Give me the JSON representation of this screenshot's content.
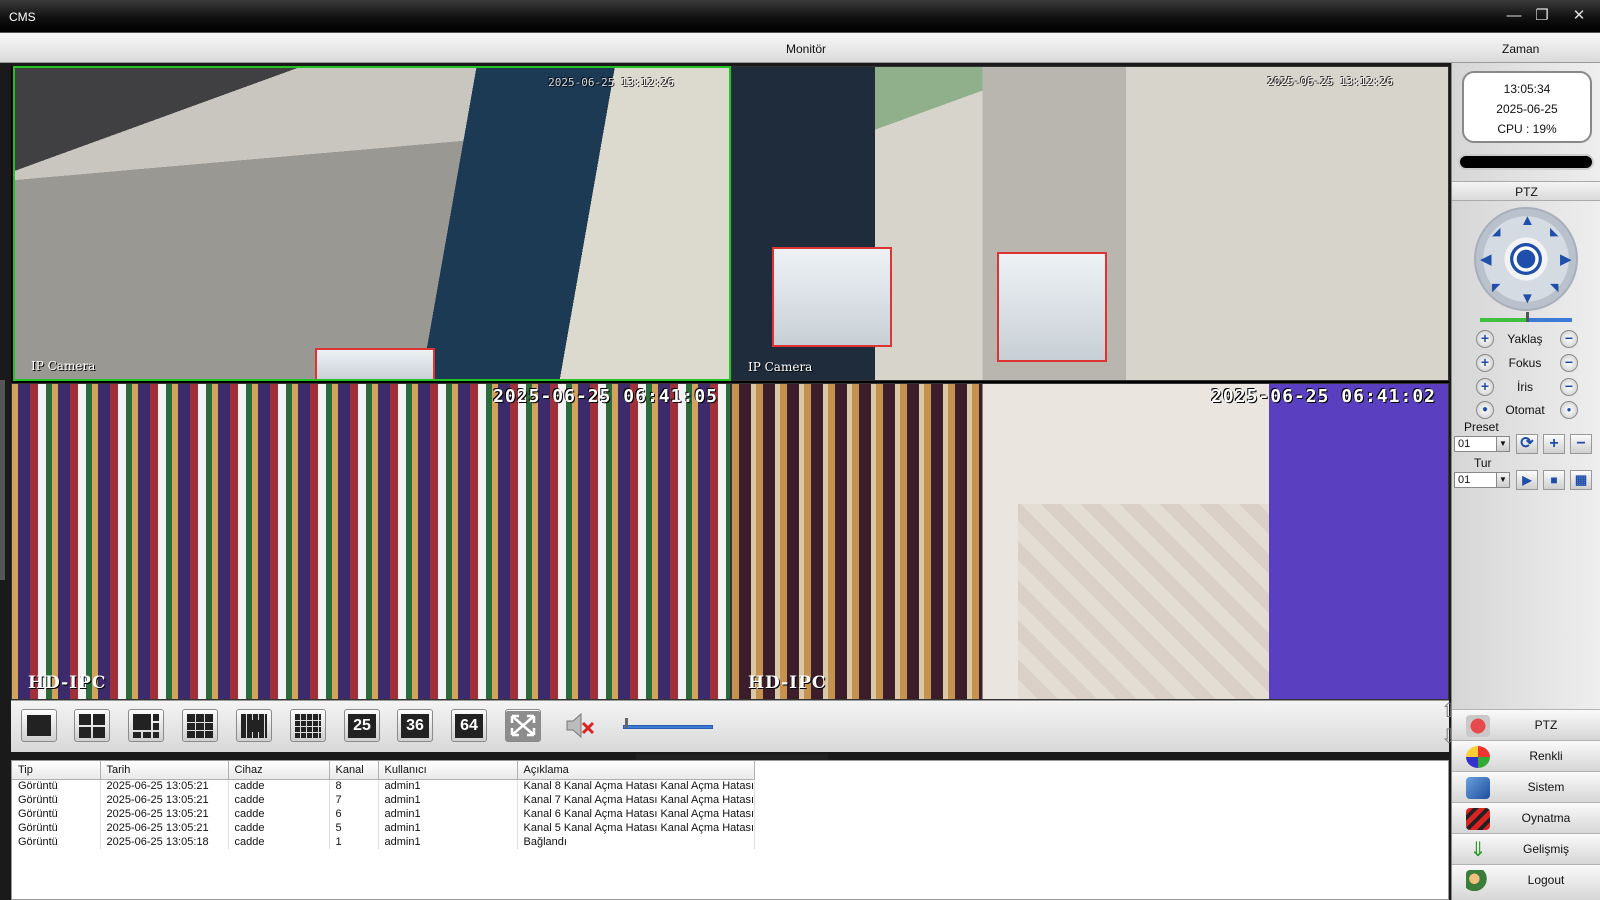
{
  "window": {
    "title": "CMS",
    "controls": [
      "minimize-icon",
      "restore-icon",
      "close-icon"
    ]
  },
  "header": {
    "monitor_label": "Monitör",
    "time_label": "Zaman"
  },
  "cameras": [
    {
      "timestamp": "2025-06-25 13:12:26",
      "label": "IP Camera",
      "selected": true
    },
    {
      "timestamp": "2025-06-25 13:12:26",
      "label": "IP Camera",
      "selected": false
    },
    {
      "timestamp": "2025-06-25 06:41:05",
      "label": "HD-IPC",
      "selected": false
    },
    {
      "timestamp": "2025-06-25 06:41:02",
      "label": "HD-IPC",
      "selected": false
    }
  ],
  "toolbar": {
    "layout_buttons": [
      "1",
      "4",
      "6",
      "9",
      "10",
      "16",
      "25",
      "36",
      "64"
    ],
    "fullscreen_icon": "fullscreen-icon",
    "mute_icon": "speaker-muted-icon",
    "volume": 0.02
  },
  "log": {
    "columns": [
      "Tip",
      "Tarih",
      "Cihaz",
      "Kanal",
      "Kullanıcı",
      "Açıklama"
    ],
    "rows": [
      [
        "Görüntü",
        "2025-06-25 13:05:21",
        "cadde",
        "8",
        "admin1",
        "Kanal 8 Kanal Açma Hatası Kanal Açma Hatası"
      ],
      [
        "Görüntü",
        "2025-06-25 13:05:21",
        "cadde",
        "7",
        "admin1",
        "Kanal 7 Kanal Açma Hatası Kanal Açma Hatası"
      ],
      [
        "Görüntü",
        "2025-06-25 13:05:21",
        "cadde",
        "6",
        "admin1",
        "Kanal 6 Kanal Açma Hatası Kanal Açma Hatası"
      ],
      [
        "Görüntü",
        "2025-06-25 13:05:21",
        "cadde",
        "5",
        "admin1",
        "Kanal 5 Kanal Açma Hatası Kanal Açma Hatası"
      ],
      [
        "Görüntü",
        "2025-06-25 13:05:18",
        "cadde",
        "1",
        "admin1",
        "Bağlandı"
      ]
    ]
  },
  "clock": {
    "time": "13:05:34",
    "date": "2025-06-25",
    "cpu": "CPU : 19%"
  },
  "ptz": {
    "title": "PTZ",
    "zoom_label": "Yaklaş",
    "focus_label": "Fokus",
    "iris_label": "İris",
    "auto_label": "Otomat",
    "preset_label": "Preset",
    "preset_value": "01",
    "tour_label": "Tur",
    "tour_value": "01",
    "speed": 0.5
  },
  "menu": {
    "items": [
      {
        "label": "PTZ",
        "icon": "ptz-icon"
      },
      {
        "label": "Renkli",
        "icon": "color-icon"
      },
      {
        "label": "Sistem",
        "icon": "system-icon"
      },
      {
        "label": "Oynatma",
        "icon": "playback-icon"
      },
      {
        "label": "Gelişmiş",
        "icon": "advanced-icon"
      },
      {
        "label": "Logout",
        "icon": "logout-icon"
      }
    ]
  },
  "colors": {
    "selected_border": "#22c322",
    "accent_blue": "#1f4faa"
  }
}
